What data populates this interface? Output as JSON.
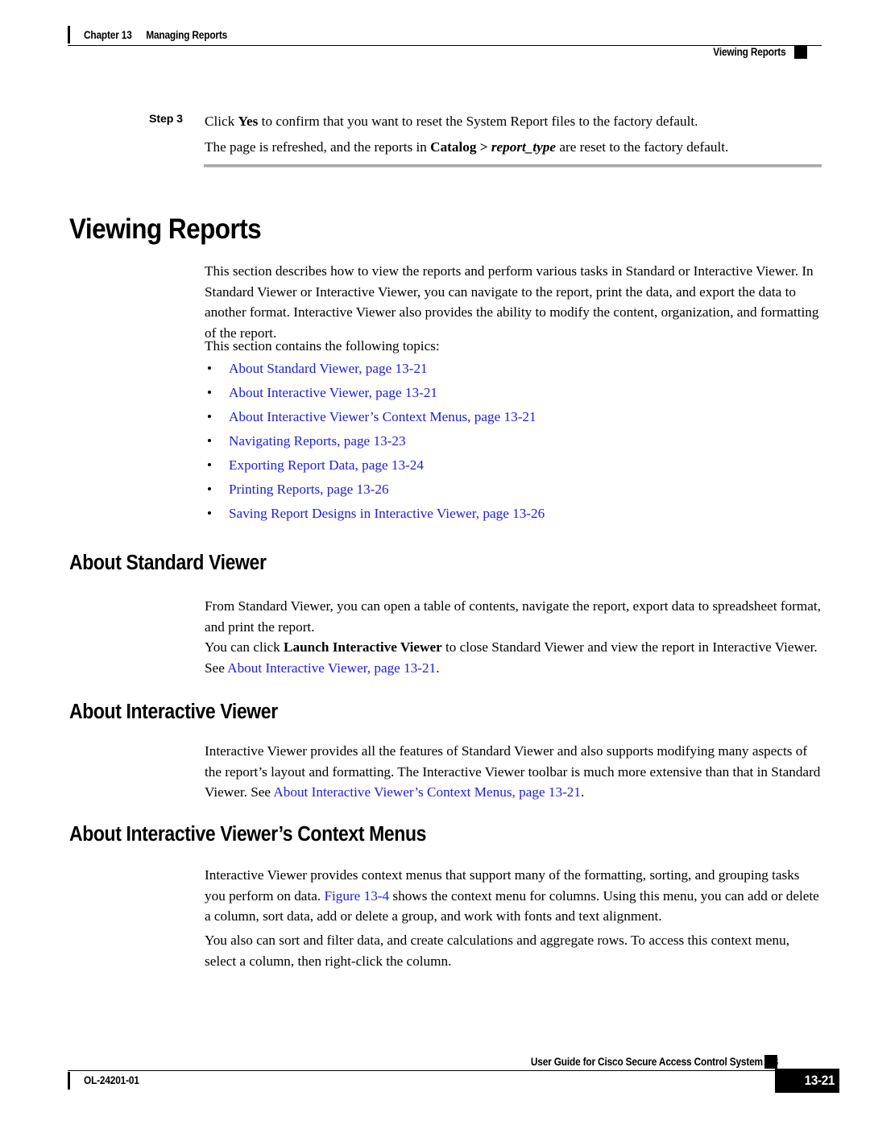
{
  "header": {
    "chapter": "Chapter 13",
    "chapter_title": "Managing Reports",
    "running_head": "Viewing Reports"
  },
  "step": {
    "label": "Step 3",
    "line1_pre": "Click ",
    "line1_bold": "Yes",
    "line1_post": " to confirm that you want to reset the System Report files to the factory default.",
    "line2_pre": "The page is refreshed, and the reports in ",
    "line2_bold": "Catalog > ",
    "line2_bold_italic": "report_type",
    "line2_post": " are reset to the factory default."
  },
  "section": {
    "title": "Viewing Reports",
    "intro": "This section describes how to view the reports and perform various tasks in Standard or Interactive Viewer. In Standard Viewer or Interactive Viewer, you can navigate to the report, print the data, and export the data to another format. Interactive Viewer also provides the ability to modify the content, organization, and formatting of the report.",
    "topics_lead": "This section contains the following topics:",
    "topics": [
      "About Standard Viewer, page 13-21",
      "About Interactive Viewer, page 13-21",
      "About Interactive Viewer’s Context Menus, page 13-21",
      "Navigating Reports, page 13-23",
      "Exporting Report Data, page 13-24",
      "Printing Reports, page 13-26",
      "Saving Report Designs in Interactive Viewer, page 13-26"
    ]
  },
  "standard_viewer": {
    "heading": "About Standard Viewer",
    "para1": "From Standard Viewer, you can open a table of contents, navigate the report, export data to spreadsheet format, and print the report.",
    "para2_pre": "You can click ",
    "para2_bold": "Launch Interactive Viewer",
    "para2_mid": " to close Standard Viewer and view the report in Interactive Viewer. See ",
    "para2_link": "About Interactive Viewer, page 13-21",
    "para2_post": "."
  },
  "interactive_viewer": {
    "heading": "About Interactive Viewer",
    "para1_pre": "Interactive Viewer provides all the features of Standard Viewer and also supports modifying many aspects of the report’s layout and formatting. The Interactive Viewer toolbar is much more extensive than that in Standard Viewer. See ",
    "para1_link": "About Interactive Viewer’s Context Menus, page 13-21",
    "para1_post": "."
  },
  "context_menus": {
    "heading": "About Interactive Viewer’s Context Menus",
    "para1_pre": "Interactive Viewer provides context menus that support many of the formatting, sorting, and grouping tasks you perform on data. ",
    "para1_link": "Figure 13-4",
    "para1_post": " shows the context menu for columns. Using this menu, you can add or delete a column, sort data, add or delete a group, and work with fonts and text alignment.",
    "para2": "You also can sort and filter data, and create calculations and aggregate rows. To access this context menu, select a column, then right-click the column."
  },
  "footer": {
    "doc_id": "OL-24201-01",
    "guide_title": "User Guide for Cisco Secure Access Control System 5.3",
    "page_number": "13-21"
  },
  "colors": {
    "link": "#2020d8",
    "rule_gray": "#a8a8a8",
    "text": "#000000"
  }
}
